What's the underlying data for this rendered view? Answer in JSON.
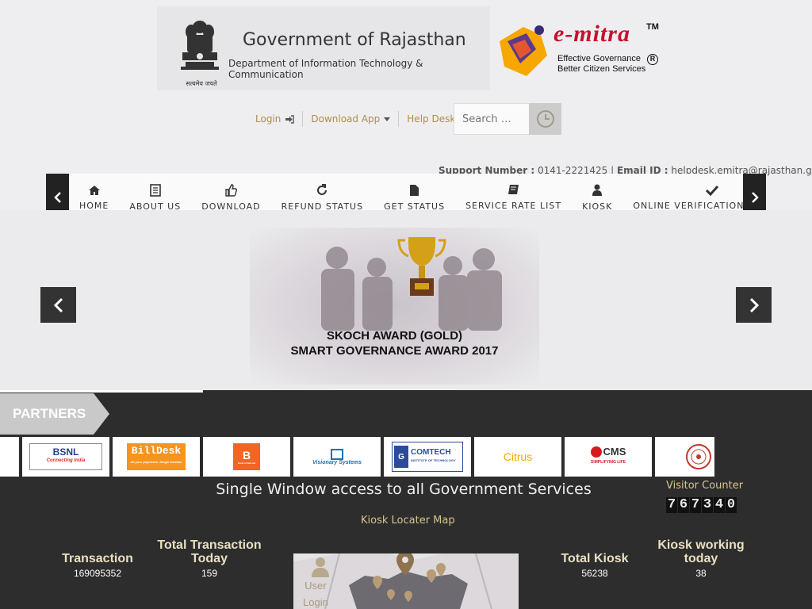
{
  "header": {
    "gov_title": "Government of Rajasthan",
    "gov_dept": "Department of Information Technology & Communication",
    "emblem_motto": "सत्यमेव जयते",
    "brand": "e-mitra",
    "brand_tm": "TM",
    "brand_reg": "R",
    "tagline1": "Effective Governance",
    "tagline2": "Better Citizen Services"
  },
  "toplinks": {
    "login": "Login",
    "download_app": "Download App",
    "help_desk": "Help Desk",
    "search_placeholder": "Search …"
  },
  "support": {
    "support_label": "Support Number :",
    "support_value": "0141-2221425",
    "email_label": "Email ID :",
    "email_value": "helpdesk.emitra@rajasthan.gov.in"
  },
  "nav": {
    "items": [
      {
        "label": "HOME",
        "icon": "home-icon"
      },
      {
        "label": "ABOUT US",
        "icon": "document-icon"
      },
      {
        "label": "DOWNLOAD",
        "icon": "thumbs-up-icon"
      },
      {
        "label": "REFUND STATUS",
        "icon": "refresh-icon"
      },
      {
        "label": "GET STATUS",
        "icon": "file-icon"
      },
      {
        "label": "SERVICE RATE LIST",
        "icon": "book-icon"
      },
      {
        "label": "KIOSK",
        "icon": "user-icon"
      },
      {
        "label": "ONLINE VERIFICATION SECTION",
        "icon": "check-icon"
      }
    ]
  },
  "slider": {
    "line1": "SKOCH AWARD (GOLD)",
    "line2": "SMART GOVERNANCE AWARD 2017"
  },
  "partners": {
    "title": "PARTNERS",
    "logos": [
      "BSNL",
      "Connecting India",
      "BillDesk",
      "All your payments. Single location",
      "Bank of Baroda",
      "Visionary Systems",
      "COMTECH",
      "INSTITUTE OF TECHNOLOGY",
      "Citrus",
      "CMS",
      "SIMPLIFYING LIFE"
    ]
  },
  "footer": {
    "single_window": "Single Window access to all Government Services",
    "visitor_label": "Visitor Counter",
    "visitor_digits": [
      "7",
      "6",
      "7",
      "3",
      "4",
      "0"
    ],
    "kiosk_link": "Kiosk Locater Map",
    "map_user_label": "User Login",
    "map_user_line1": "User",
    "map_user_line2": "Login"
  },
  "stats": {
    "transaction": {
      "label": "Transaction",
      "value": "169095352"
    },
    "transaction_today": {
      "label1": "Total Transaction",
      "label2": "Today",
      "value": "159"
    },
    "total_kiosk": {
      "label": "Total Kiosk",
      "value": "56238"
    },
    "kiosk_today": {
      "label1": "Kiosk working",
      "label2": "today",
      "value": "38"
    }
  },
  "colors": {
    "accent": "#b08c4a",
    "dark_bg": "#2d2d2d",
    "nav_arrow": "#222222",
    "brand_red": "#c8102e",
    "stat_label": "#e9dfc0"
  }
}
